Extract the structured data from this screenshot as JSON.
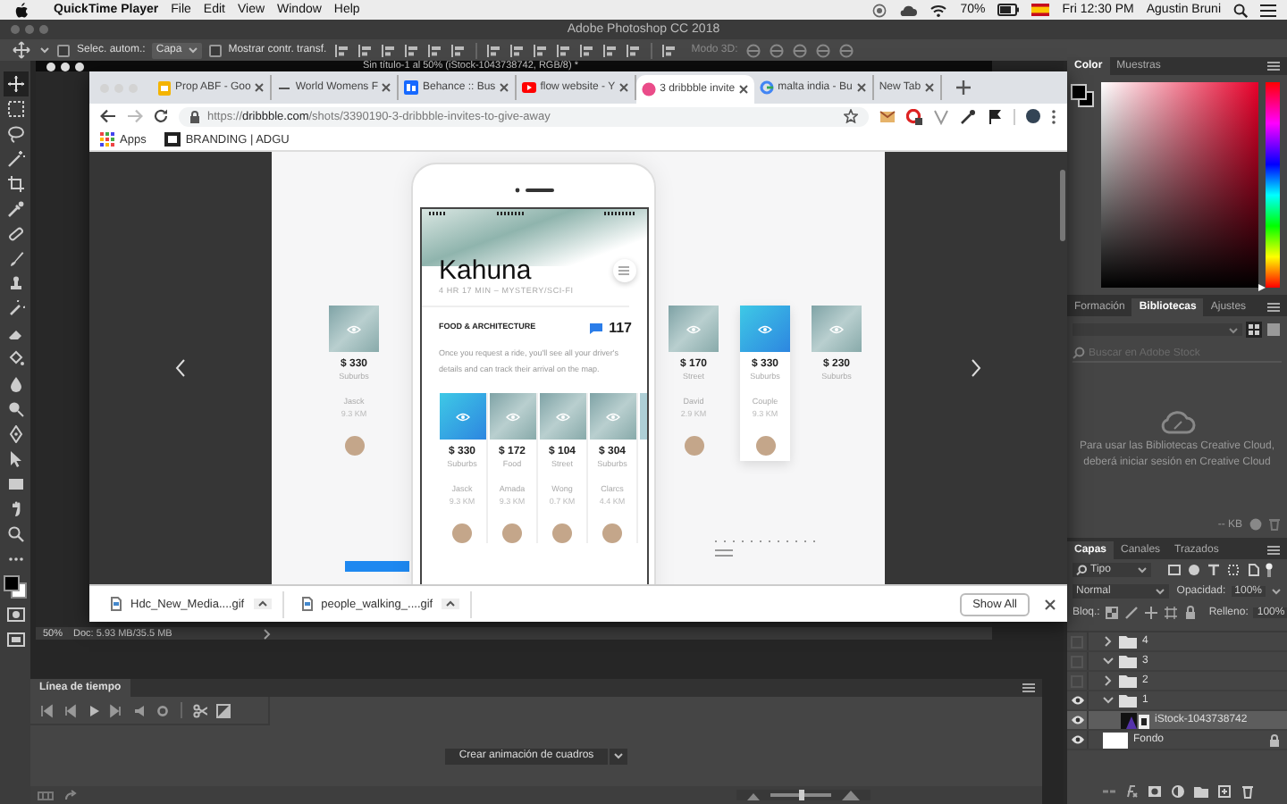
{
  "menubar": {
    "app": "QuickTime Player",
    "menus": [
      "File",
      "Edit",
      "View",
      "Window",
      "Help"
    ],
    "battery": "70%",
    "clock": "Fri 12:30 PM",
    "user": "Agustin Bruni"
  },
  "photoshop": {
    "title": "Adobe Photoshop CC 2018",
    "options": {
      "auto_select_label": "Selec. autom.:",
      "auto_select_checked": false,
      "target": "Capa",
      "transform_label": "Mostrar contr. transf.",
      "transform_checked": false,
      "mode_3d": "Modo 3D:"
    },
    "document": {
      "title": "Sin título-1 al 50% (iStock-1043738742, RGB/8) *",
      "zoom": "50%",
      "doc_size": "Doc: 5.93 MB/35.5 MB"
    },
    "color_panel": {
      "tabs": [
        {
          "label": "Color",
          "selected": true
        },
        {
          "label": "Muestras",
          "selected": false
        }
      ],
      "hue_slider": {
        "level": 0
      }
    },
    "libraries_panel": {
      "tabs": [
        {
          "label": "Formación",
          "selected": false
        },
        {
          "label": "Bibliotecas",
          "selected": true
        },
        {
          "label": "Ajustes",
          "selected": false
        }
      ],
      "search_placeholder": "Buscar en Adobe Stock",
      "message": "Para usar las Bibliotecas Creative Cloud, deberá iniciar sesión en Creative Cloud",
      "size": "-- KB"
    },
    "layers_panel": {
      "tabs": [
        {
          "label": "Capas",
          "selected": true
        },
        {
          "label": "Canales",
          "selected": false
        },
        {
          "label": "Trazados",
          "selected": false
        }
      ],
      "filter": "Tipo",
      "blend_mode": "Normal",
      "opacity_label": "Opacidad:",
      "opacity": "100%",
      "lock_label": "Bloq.:",
      "fill_label": "Relleno:",
      "fill": "100%",
      "layers": [
        {
          "name": "4",
          "kind": "group",
          "visible": false,
          "expanded": false,
          "selected": false,
          "locked": false
        },
        {
          "name": "3",
          "kind": "group",
          "visible": false,
          "expanded": true,
          "selected": false,
          "locked": false
        },
        {
          "name": "2",
          "kind": "group",
          "visible": false,
          "expanded": false,
          "selected": false,
          "locked": false
        },
        {
          "name": "1",
          "kind": "group",
          "visible": true,
          "expanded": true,
          "selected": false,
          "locked": false,
          "children": [
            {
              "name": "iStock-1043738742",
              "kind": "image",
              "visible": true,
              "selected": true,
              "locked": false
            }
          ]
        },
        {
          "name": "Fondo",
          "kind": "background",
          "visible": true,
          "selected": false,
          "locked": true
        }
      ]
    },
    "timeline": {
      "title": "Línea de tiempo",
      "create_button": "Crear animación de cuadros",
      "zoom_slider": {
        "level": 0.5
      }
    }
  },
  "browser": {
    "tabs": [
      {
        "title": "Prop ABF - Goo",
        "kind": "slides",
        "selected": false
      },
      {
        "title": "World Womens F",
        "kind": "dash",
        "selected": false
      },
      {
        "title": "Behance :: Bus",
        "kind": "behance",
        "selected": false
      },
      {
        "title": "flow website - Y",
        "kind": "youtube",
        "selected": false
      },
      {
        "title": "3 dribbble invite",
        "kind": "dribbble",
        "selected": true
      },
      {
        "title": "malta india - Bu",
        "kind": "google",
        "selected": false
      },
      {
        "title": "New Tab",
        "kind": "blank",
        "selected": false
      }
    ],
    "url": {
      "scheme": "https://",
      "host": "dribbble.com",
      "path": "/shots/3390190-3-dribbble-invites-to-give-away"
    },
    "bookmarks": [
      {
        "label": "Apps",
        "kind": "apps"
      },
      {
        "label": "BRANDING | ADGU",
        "kind": "folder"
      }
    ],
    "shot": {
      "title": "Kahuna",
      "subtitle": "4 HR 17 MIN – MYSTERY/SCI-FI",
      "section": "FOOD & ARCHITECTURE",
      "count": "117",
      "text": "Once you request a ride, you'll see all your driver's details and can track their arrival on the map.",
      "cards": [
        {
          "price": "$ 330",
          "area": "Suburbs",
          "person": "Jasck",
          "distance": "9.3 KM",
          "kind": "gradient"
        },
        {
          "price": "$ 172",
          "area": "Food",
          "person": "Amada",
          "distance": "9.3 KM",
          "kind": "photo"
        },
        {
          "price": "$ 104",
          "area": "Street",
          "person": "Wong",
          "distance": "0.7 KM",
          "kind": "photo"
        },
        {
          "price": "$ 304",
          "area": "Suburbs",
          "person": "Clarcs",
          "distance": "4.4 KM",
          "kind": "photo"
        }
      ],
      "left_cards": [
        {
          "price": "$ 330",
          "area": "Suburbs",
          "person": "Jasck",
          "distance": "9.3 KM",
          "kind": "photo",
          "raised": false
        }
      ],
      "right_cards": [
        {
          "price": "$ 170",
          "area": "Street",
          "person": "David",
          "distance": "2.9 KM",
          "kind": "photo",
          "raised": false
        },
        {
          "price": "$ 330",
          "area": "Suburbs",
          "person": "Couple",
          "distance": "9.3 KM",
          "kind": "gradient",
          "raised": true
        },
        {
          "price": "$ 230",
          "area": "Suburbs",
          "kind": "photo",
          "raised": false
        }
      ]
    },
    "downloads": [
      {
        "name": "Hdc_New_Media....gif"
      },
      {
        "name": "people_walking_....gif"
      }
    ],
    "show_all": "Show All"
  }
}
